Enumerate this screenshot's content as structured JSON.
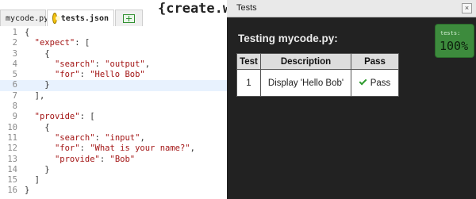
{
  "editor": {
    "tabs": [
      {
        "label": "mycode.py"
      },
      {
        "label": "tests.json"
      }
    ],
    "title_fragment": "{create.w",
    "lines": [
      [
        "1",
        "{"
      ],
      [
        "2",
        "  \"expect\": ["
      ],
      [
        "3",
        "    {"
      ],
      [
        "4",
        "      \"search\": \"output\","
      ],
      [
        "5",
        "      \"for\": \"Hello Bob\""
      ],
      [
        "6",
        "    }"
      ],
      [
        "7",
        "  ],"
      ],
      [
        "8",
        ""
      ],
      [
        "9",
        "  \"provide\": ["
      ],
      [
        "10",
        "    {"
      ],
      [
        "11",
        "      \"search\": \"input\","
      ],
      [
        "12",
        "      \"for\": \"What is your name?\","
      ],
      [
        "13",
        "      \"provide\": \"Bob\""
      ],
      [
        "14",
        "    }"
      ],
      [
        "15",
        "  ]"
      ],
      [
        "16",
        "}"
      ]
    ],
    "highlighted_line": 6
  },
  "panel": {
    "title": "Tests",
    "close_label": "×",
    "testing_label": "Testing mycode.py:",
    "score": {
      "label": "tests:",
      "value": "100%"
    },
    "table": {
      "headers": [
        "Test",
        "Description",
        "Pass"
      ],
      "rows": [
        {
          "test": "1",
          "description": "Display 'Hello Bob'",
          "pass": "Pass"
        }
      ]
    }
  }
}
